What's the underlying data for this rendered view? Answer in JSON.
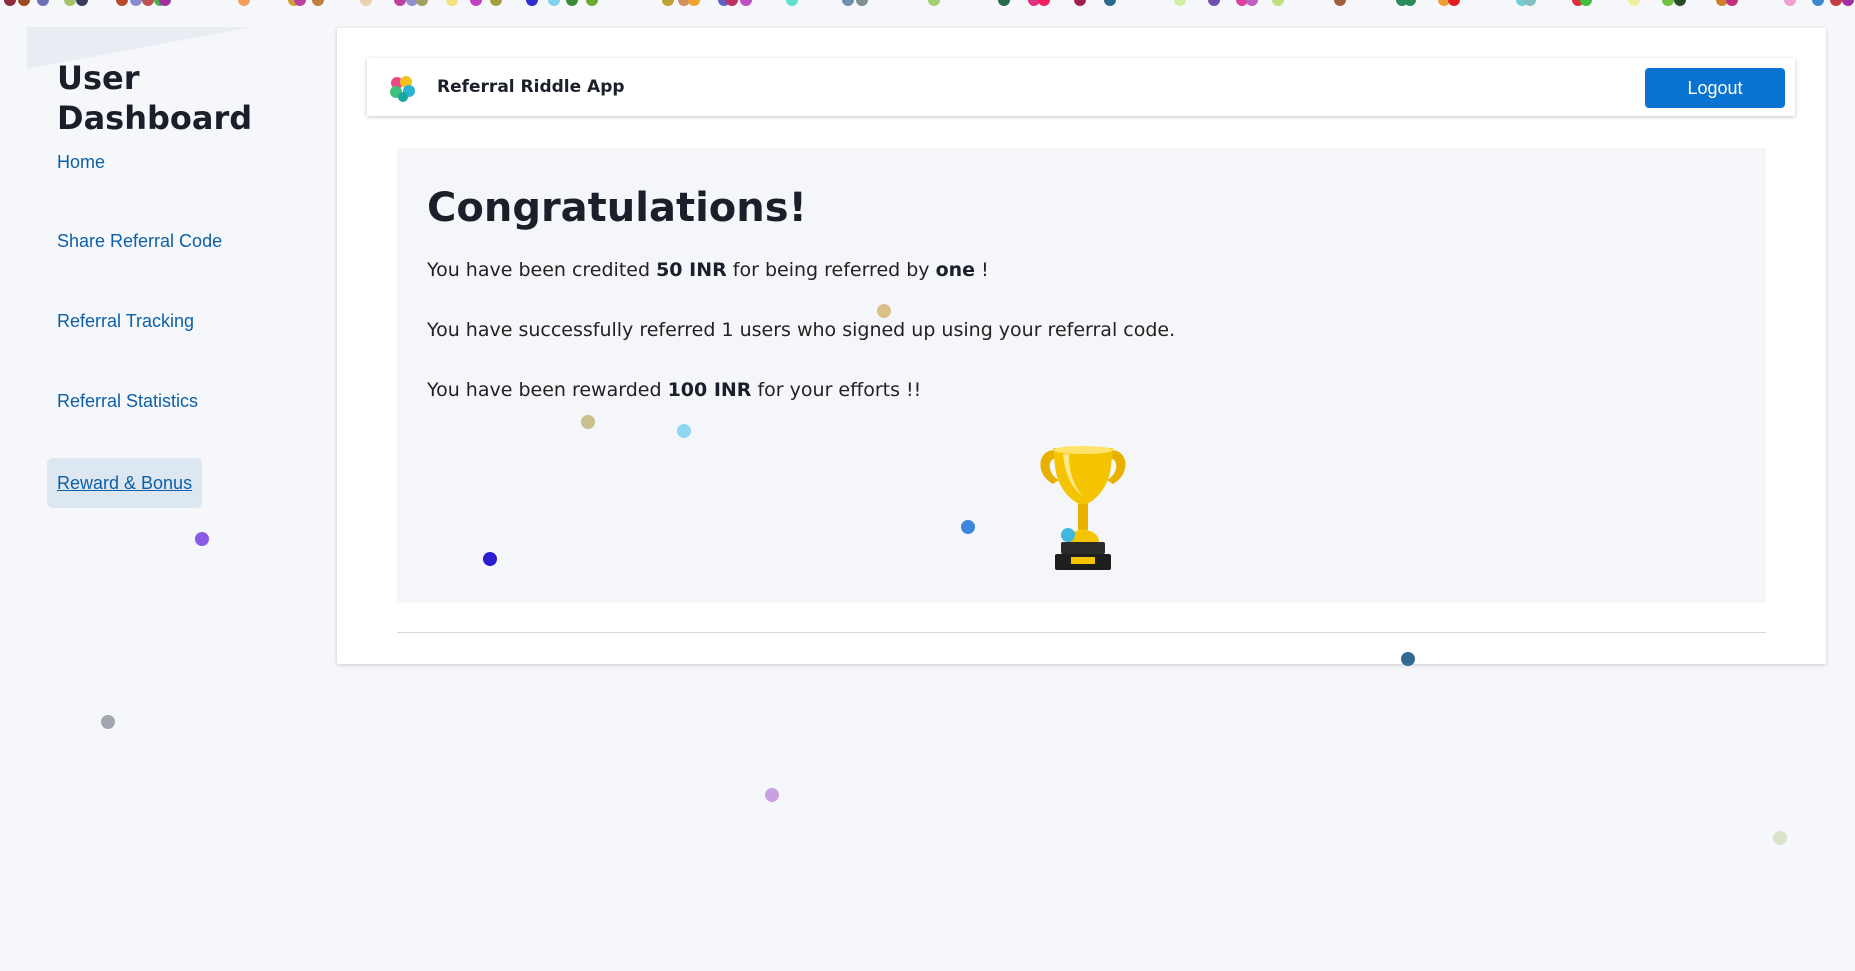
{
  "sidebar": {
    "title": "User Dashboard",
    "items": [
      {
        "label": "Home"
      },
      {
        "label": "Share Referral Code"
      },
      {
        "label": "Referral Tracking"
      },
      {
        "label": "Referral Statistics"
      },
      {
        "label": "Reward & Bonus",
        "active": true
      }
    ]
  },
  "header": {
    "app_name": "Referral Riddle App",
    "logo_icon": "colorful-dots-logo-icon",
    "logout_label": "Logout"
  },
  "main": {
    "heading": "Congratulations!",
    "credit": {
      "prefix": "You have been credited ",
      "amount": "50 INR",
      "middle": " for being referred by ",
      "referrer": "one",
      "suffix": " !"
    },
    "referrals_text": "You have successfully referred 1 users who signed up using your referral code.",
    "reward": {
      "prefix": "You have been rewarded ",
      "amount": "100 INR",
      "suffix": " for your efforts !!"
    },
    "trophy_icon": "trophy-icon"
  },
  "colors": {
    "link": "#0d5fa6",
    "logout_bg": "#0a73d1",
    "active_item_bg": "#dde7f1",
    "page_bg": "#f6f7fa",
    "trophy_gold": "#f5c400"
  }
}
